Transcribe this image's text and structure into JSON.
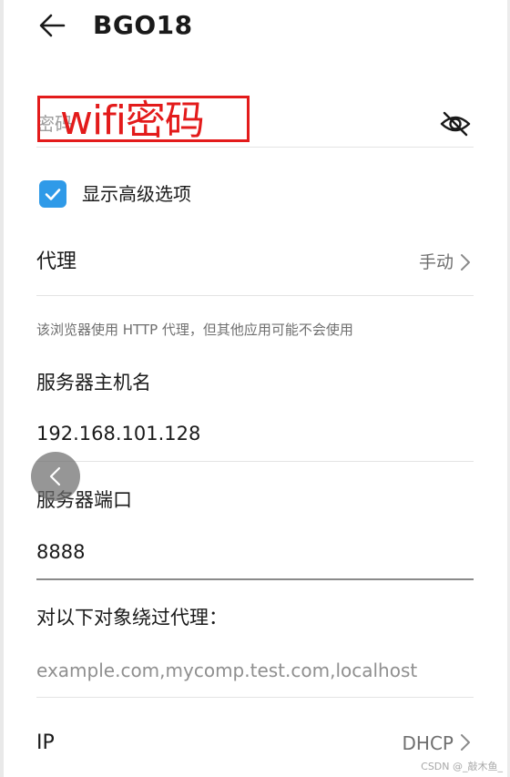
{
  "header": {
    "title": "BGO18"
  },
  "password": {
    "placeholder": "密码",
    "annotation": "wifi密码"
  },
  "advanced": {
    "label": "显示高级选项",
    "checked": true
  },
  "proxy": {
    "label": "代理",
    "value": "手动"
  },
  "hint": "该浏览器使用 HTTP 代理，但其他应用可能不会使用",
  "host": {
    "label": "服务器主机名",
    "value": "192.168.101.128"
  },
  "port": {
    "label": "服务器端口",
    "value": "8888"
  },
  "bypass": {
    "label": "对以下对象绕过代理：",
    "placeholder": "example.com,mycomp.test.com,localhost"
  },
  "ip": {
    "label": "IP",
    "value": "DHCP"
  },
  "watermark": "CSDN @_敲木鱼_",
  "colors": {
    "checkbox": "#2f9ae8",
    "annotation": "#e31b1b"
  }
}
